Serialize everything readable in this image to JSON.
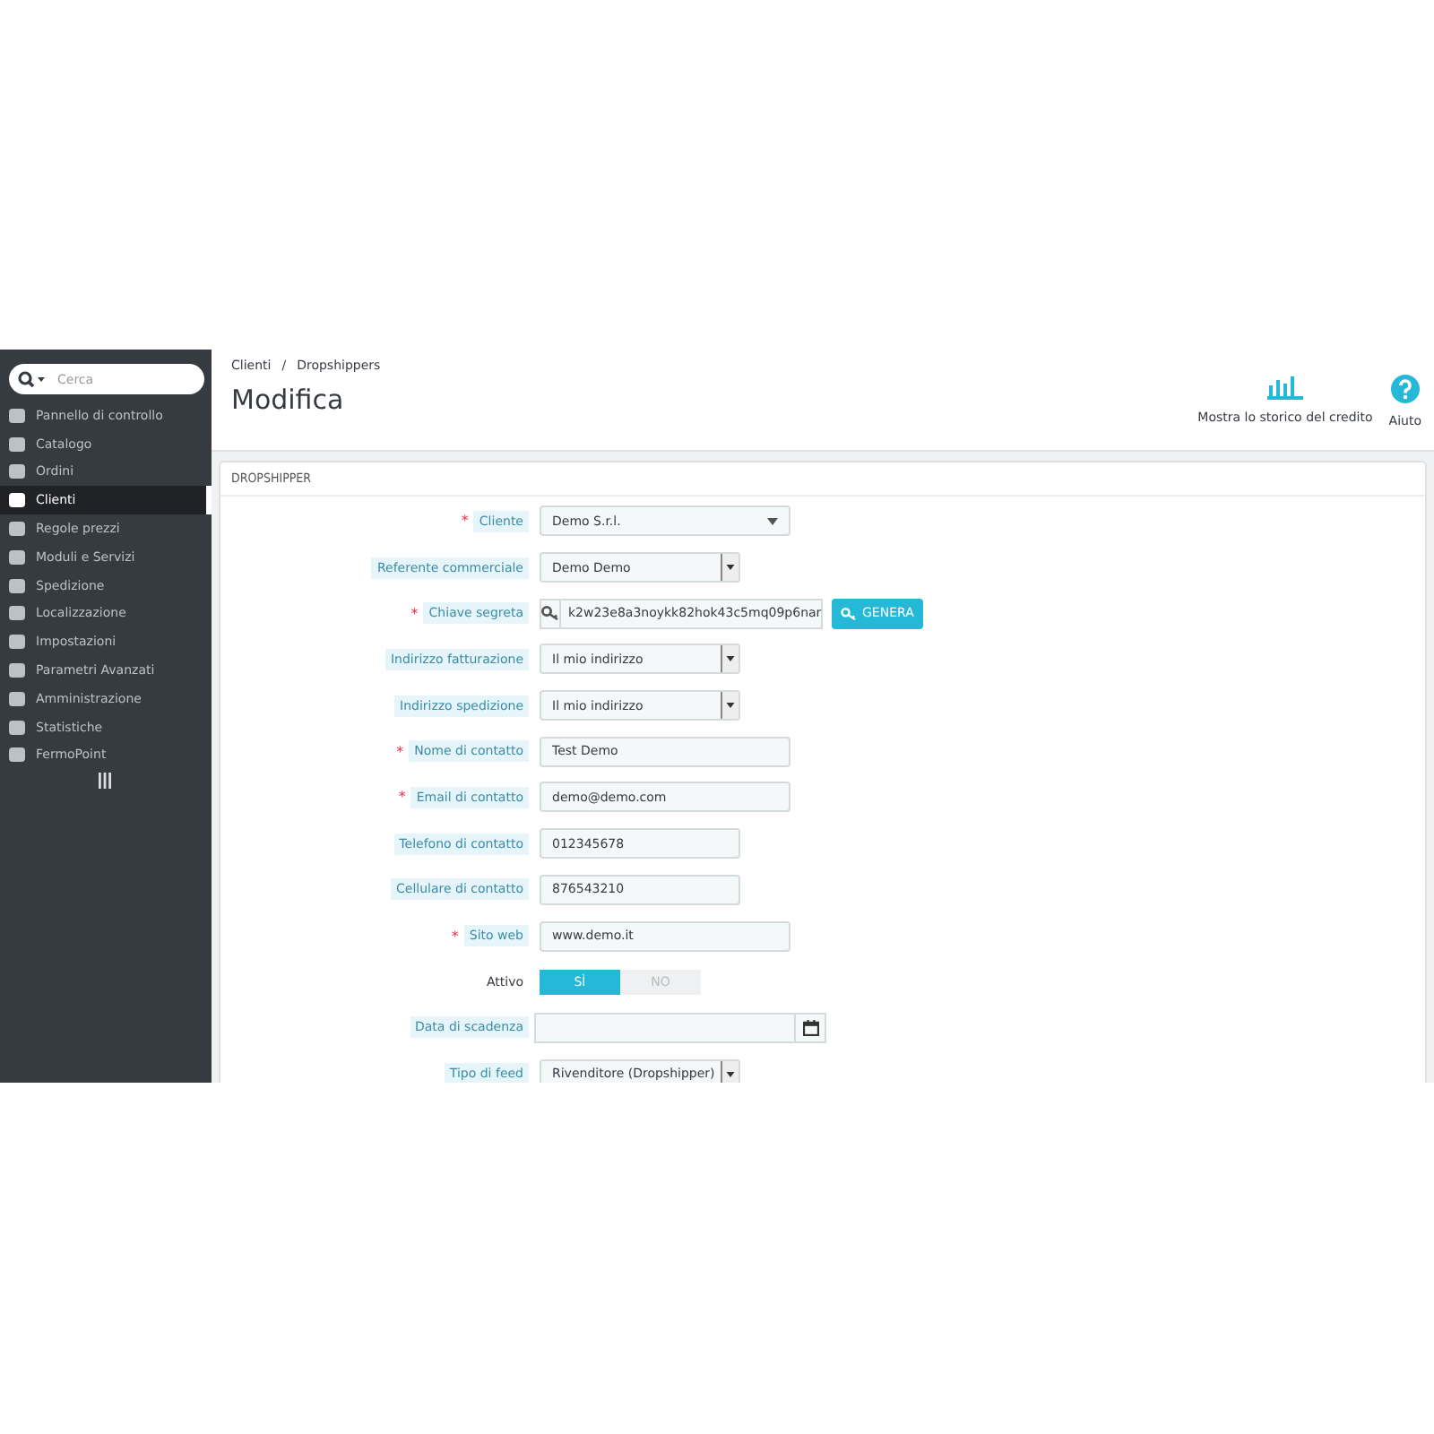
{
  "search": {
    "placeholder": "Cerca"
  },
  "sidebar": {
    "items": [
      {
        "label": "Pannello di controllo",
        "selected": false
      },
      {
        "label": "Catalogo",
        "selected": false
      },
      {
        "label": "Ordini",
        "selected": false
      },
      {
        "label": "Clienti",
        "selected": true
      },
      {
        "label": "Regole prezzi",
        "selected": false
      },
      {
        "label": "Moduli e Servizi",
        "selected": false
      },
      {
        "label": "Spedizione",
        "selected": false
      },
      {
        "label": "Localizzazione",
        "selected": false
      },
      {
        "label": "Impostazioni",
        "selected": false
      },
      {
        "label": "Parametri Avanzati",
        "selected": false
      },
      {
        "label": "Amministrazione",
        "selected": false
      },
      {
        "label": "Statistiche",
        "selected": false
      },
      {
        "label": "FermoPoint",
        "selected": false
      }
    ]
  },
  "breadcrumb": [
    "Clienti",
    "Dropshippers"
  ],
  "breadcrumb_separator": "/",
  "page_title": "Modifica",
  "toolbar": [
    {
      "kind": "chart",
      "label": "Mostra lo storico del credito"
    },
    {
      "kind": "help",
      "label": "Aiuto"
    }
  ],
  "panel": {
    "heading": "DROPSHIPPER",
    "fields": [
      {
        "label": "Cliente",
        "required_mark": "*",
        "help": true,
        "kind": "select",
        "value": "Demo S.r.l."
      },
      {
        "label": "Referente commerciale",
        "help": true,
        "kind": "combo",
        "value": "Demo Demo"
      },
      {
        "label": "Chiave segreta",
        "required_mark": "*",
        "help": true,
        "kind": "key",
        "value": "k2w23e8a3noykk82hok43c5mq09p6nar",
        "button": "GENERA"
      },
      {
        "label": "Indirizzo fatturazione",
        "help": true,
        "kind": "combo",
        "value": "Il mio indirizzo"
      },
      {
        "label": "Indirizzo spedizione",
        "help": true,
        "kind": "combo",
        "value": "Il mio indirizzo"
      },
      {
        "label": "Nome di contatto",
        "required_mark": "*",
        "help": true,
        "kind": "text",
        "value": "Test Demo"
      },
      {
        "label": "Email di contatto",
        "required_mark": "*",
        "help": true,
        "kind": "text",
        "value": "demo@demo.com"
      },
      {
        "label": "Telefono di contatto",
        "help": true,
        "kind": "phone",
        "value": "012345678"
      },
      {
        "label": "Cellulare di contatto",
        "help": true,
        "kind": "phone",
        "value": "876543210"
      },
      {
        "label": "Sito web",
        "required_mark": "*",
        "help": true,
        "kind": "text",
        "value": "www.demo.it"
      },
      {
        "label": "Attivo",
        "help": false,
        "kind": "switch",
        "options": [
          {
            "label": "SÌ",
            "selected": true
          },
          {
            "label": "NO",
            "selected": false
          }
        ]
      },
      {
        "label": "Data di scadenza",
        "help": true,
        "kind": "date"
      },
      {
        "label": "Tipo di feed",
        "help": true,
        "kind": "combo",
        "value": "Rivenditore (Dropshipper)"
      }
    ]
  }
}
